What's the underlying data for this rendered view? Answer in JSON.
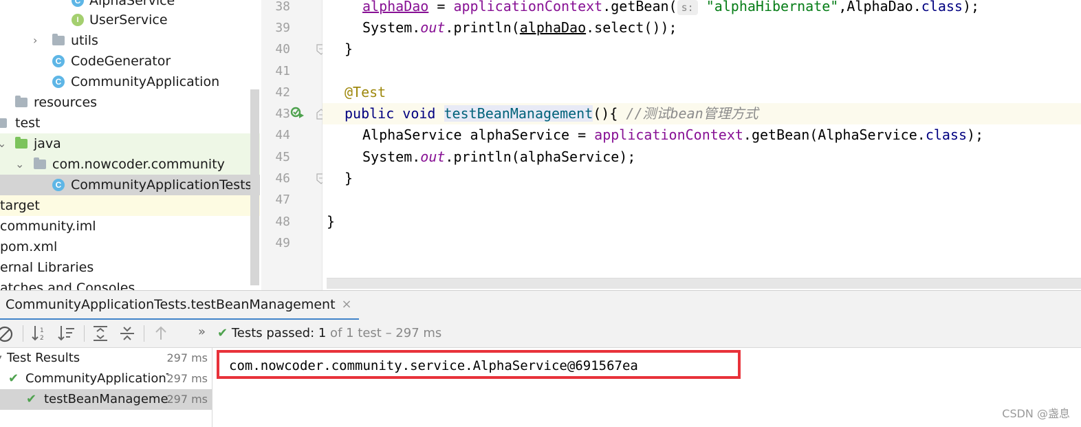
{
  "project_tree": {
    "items": [
      {
        "label": "AlphaService",
        "icon": "class-icon",
        "icon_letter": "C"
      },
      {
        "label": "UserService",
        "icon": "interface-icon",
        "icon_letter": "I"
      },
      {
        "label": "utils",
        "icon": "package-folder-icon"
      },
      {
        "label": "CodeGenerator",
        "icon": "class-icon",
        "icon_letter": "C"
      },
      {
        "label": "CommunityApplication",
        "icon": "spring-boot-class-icon",
        "icon_letter": "C"
      },
      {
        "label": "resources",
        "icon": "resources-folder-icon"
      },
      {
        "label": "test",
        "icon": "folder-icon"
      },
      {
        "label": "java",
        "icon": "test-root-folder-icon"
      },
      {
        "label": "com.nowcoder.community",
        "icon": "package-folder-icon"
      },
      {
        "label": "CommunityApplicationTests",
        "icon": "test-class-icon",
        "icon_letter": "C"
      },
      {
        "label": "target",
        "icon": "folder-icon"
      },
      {
        "label": "community.iml",
        "icon": "file-icon"
      },
      {
        "label": "pom.xml",
        "icon": "file-icon"
      },
      {
        "label": "ernal Libraries",
        "icon": "library-icon"
      },
      {
        "label": "atches and Consoles",
        "icon": "console-icon"
      }
    ]
  },
  "editor": {
    "line_numbers": [
      "38",
      "39",
      "40",
      "41",
      "42",
      "43",
      "44",
      "45",
      "46",
      "47",
      "48",
      "49"
    ],
    "lines": {
      "l38": {
        "a": "alphaDao",
        "b": " = ",
        "c": "applicationContext",
        "d": ".getBean(",
        "hint": "s:",
        "e": "\"alphaHibernate\"",
        "f": ",AlphaDao.",
        "g": "class",
        "h": ");"
      },
      "l39": {
        "a": "System.",
        "b": "out",
        "c": ".println(",
        "d": "alphaDao",
        "e": ".select());"
      },
      "l40": {
        "a": "}"
      },
      "l42": {
        "a": "@Test"
      },
      "l43": {
        "a": "public void ",
        "b": "testBeanManagement",
        "c": "(){ ",
        "d": "//测试bean管理方式"
      },
      "l44": {
        "a": "AlphaService alphaService = ",
        "b": "applicationContext",
        "c": ".getBean(AlphaService.",
        "d": "class",
        "e": ");"
      },
      "l45": {
        "a": "System.",
        "b": "out",
        "c": ".println(alphaService);"
      },
      "l46": {
        "a": "}"
      },
      "l48": {
        "a": "}"
      }
    }
  },
  "run_panel": {
    "tab_label": "CommunityApplicationTests.testBeanManagement",
    "tab_close": "×",
    "more": "»",
    "status": {
      "prefix": "Tests passed: ",
      "count": "1",
      "suffix": " of 1 test – 297 ms"
    },
    "results": [
      {
        "label": "Test Results",
        "time": "297 ms"
      },
      {
        "label": "CommunityApplicationT",
        "time": "297 ms"
      },
      {
        "label": "testBeanManagemen",
        "time": "297 ms"
      }
    ],
    "console_output": "com.nowcoder.community.service.AlphaService@691567ea"
  },
  "watermark": "CSDN @盏息",
  "colors": {
    "highlight_box": "#e8323a",
    "pass": "#4ea24e",
    "keyword": "#000080",
    "field": "#871094"
  }
}
